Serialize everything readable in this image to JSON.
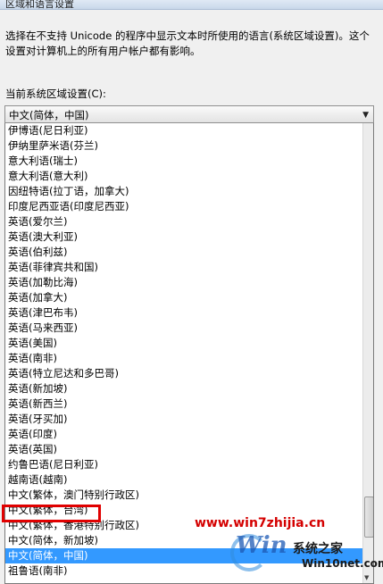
{
  "window": {
    "title": "区域和语言设置"
  },
  "description": "选择在不支持 Unicode 的程序中显示文本时所使用的语言(系统区域设置)。这个设置对计算机上的所有用户帐户都有影响。",
  "locale_label": "当前系统区域设置(C):",
  "combo": {
    "selected": "中文(简体，中国)",
    "arrow_icon": "chevron-down-icon"
  },
  "list": {
    "items": [
      "伊博语(尼日利亚)",
      "伊纳里萨米语(芬兰)",
      "意大利语(瑞士)",
      "意大利语(意大利)",
      "因纽特语(拉丁语，加拿大)",
      "印度尼西亚语(印度尼西亚)",
      "英语(爱尔兰)",
      "英语(澳大利亚)",
      "英语(伯利兹)",
      "英语(菲律宾共和国)",
      "英语(加勒比海)",
      "英语(加拿大)",
      "英语(津巴布韦)",
      "英语(马来西亚)",
      "英语(美国)",
      "英语(南非)",
      "英语(特立尼达和多巴哥)",
      "英语(新加坡)",
      "英语(新西兰)",
      "英语(牙买加)",
      "英语(印度)",
      "英语(英国)",
      "约鲁巴语(尼日利亚)",
      "越南语(越南)",
      "中文(繁体，澳门特别行政区)",
      "中文(繁体，台湾)",
      "中文(繁体，香港特别行政区)",
      "中文(简体，新加坡)",
      "中文(简体，中国)",
      "祖鲁语(南非)"
    ],
    "selected_index": 28,
    "highlighted_index": 25
  },
  "watermark": {
    "site1": "www.win7zhijia.cn",
    "logo": "Win",
    "brand": "系统之家",
    "site2": "Win10net.com",
    "highlight_color": "#e00000"
  }
}
